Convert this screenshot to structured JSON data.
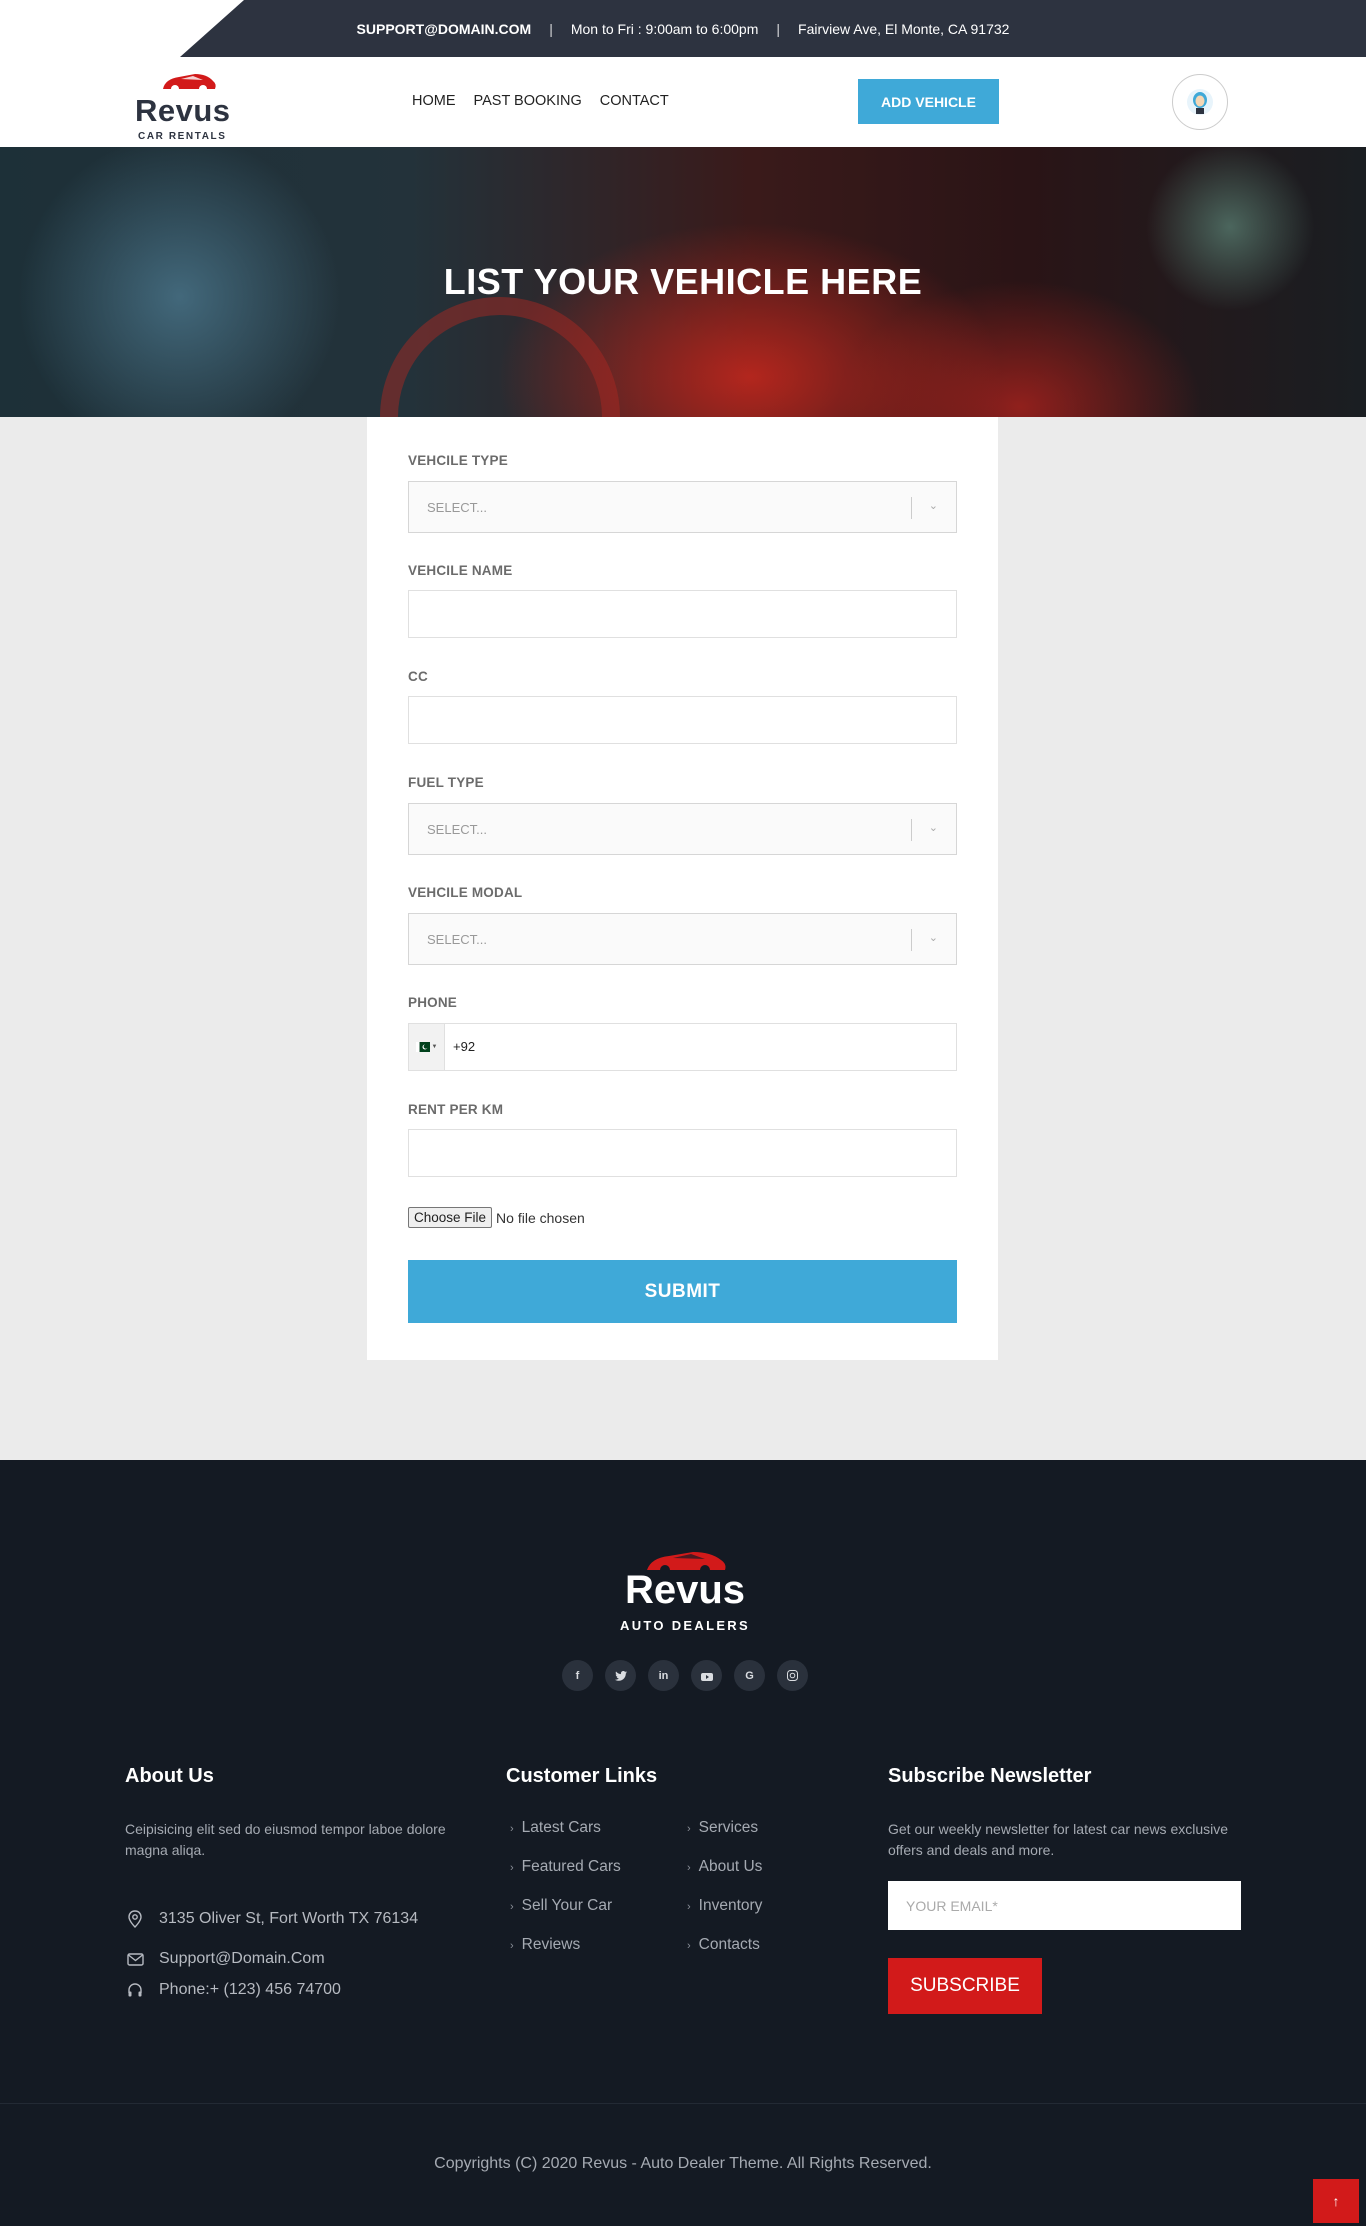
{
  "topbar": {
    "email": "SUPPORT@DOMAIN.COM",
    "separator": "|",
    "hours": "Mon to Fri : 9:00am to 6:00pm",
    "address": "Fairview Ave, El Monte, CA 91732"
  },
  "header": {
    "logo_name": "Revus",
    "logo_sub": "CAR RENTALS",
    "nav": [
      "HOME",
      "PAST BOOKING",
      "CONTACT"
    ],
    "add_vehicle": "ADD VEHICLE"
  },
  "hero": {
    "title": "LIST YOUR VEHICLE HERE"
  },
  "form": {
    "vehicle_type_label": "VEHCILE TYPE",
    "vehicle_type_value": "SELECT...",
    "vehicle_name_label": "VEHCILE NAME",
    "cc_label": "CC",
    "fuel_type_label": "FUEL TYPE",
    "fuel_type_value": "SELECT...",
    "vehicle_modal_label": "VEHCILE MODAL",
    "vehicle_modal_value": "SELECT...",
    "phone_label": "PHONE",
    "phone_code": "+92",
    "rent_label": "RENT PER KM",
    "file_button": "Choose File",
    "file_status": "No file chosen",
    "submit": "SUBMIT"
  },
  "footer": {
    "logo_name": "Revus",
    "logo_sub": "AUTO DEALERS",
    "socials": [
      "f",
      "t",
      "in",
      "yt",
      "G",
      "ig"
    ],
    "about_title": "About Us",
    "about_text": "Ceipisicing elit sed do eiusmod tempor laboe dolore magna aliqa.",
    "address": "3135 Oliver St, Fort Worth TX 76134",
    "email": "Support@Domain.Com",
    "phone": "Phone:+ (123) 456 74700",
    "links_title": "Customer Links",
    "links_left": [
      "Latest Cars",
      "Featured Cars",
      "Sell Your Car",
      "Reviews"
    ],
    "links_right": [
      "Services",
      "About Us",
      "Inventory",
      "Contacts"
    ],
    "newsletter_title": "Subscribe Newsletter",
    "newsletter_text": "Get our weekly newsletter for latest car news exclusive offers and deals and more.",
    "email_placeholder": "YOUR EMAIL*",
    "subscribe": "SUBSCRIBE",
    "copyright": "Copyrights (C) 2020 Revus - Auto Dealer Theme. All Rights Reserved."
  },
  "colors": {
    "accent": "#3fa9d8",
    "brand_red": "#d21a1a",
    "topbar": "#2d3340",
    "footer": "#141a23"
  }
}
